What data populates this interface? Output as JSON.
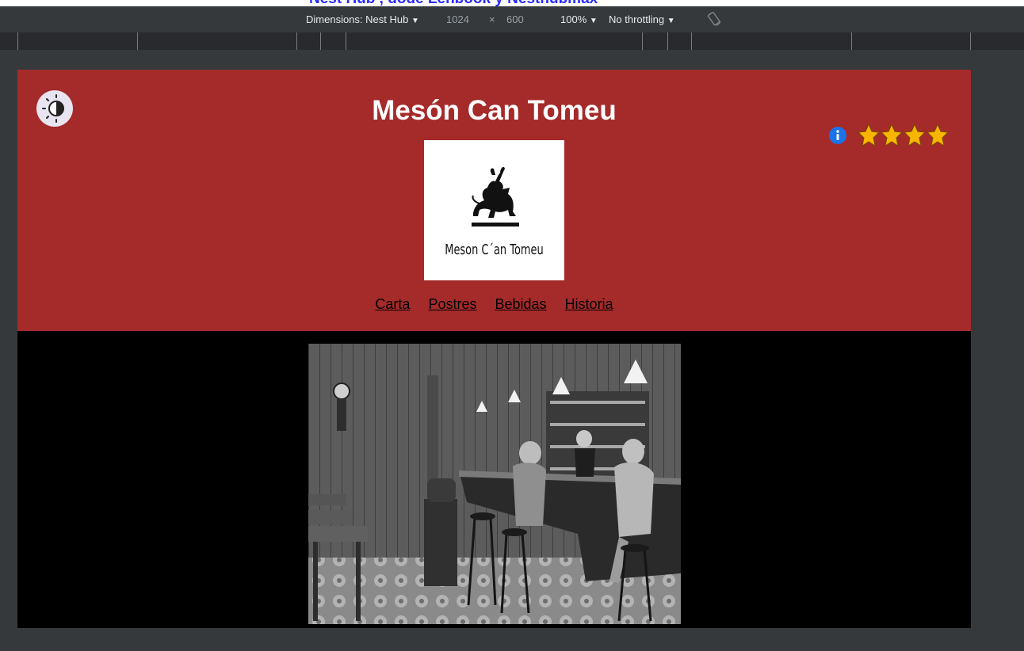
{
  "caption": {
    "text": "Nest Hub , dode Lenbook y Nesthubmax"
  },
  "devtools": {
    "dimensions_label": "Dimensions: Nest Hub",
    "width": "1024",
    "times": "×",
    "height": "600",
    "zoom": "100%",
    "throttling": "No throttling",
    "dropdown_glyph": "▼",
    "rotate_icon": "rotate-icon"
  },
  "site": {
    "title": "Mesón Can Tomeu",
    "logo_text": "Meson C´an Tomeu",
    "rating": 4,
    "nav": [
      "Carta",
      "Postres",
      "Bebidas",
      "Historia"
    ]
  },
  "colors": {
    "header_bg": "#a52a2a",
    "star": "#f7b500",
    "info": "#1a73e8"
  }
}
